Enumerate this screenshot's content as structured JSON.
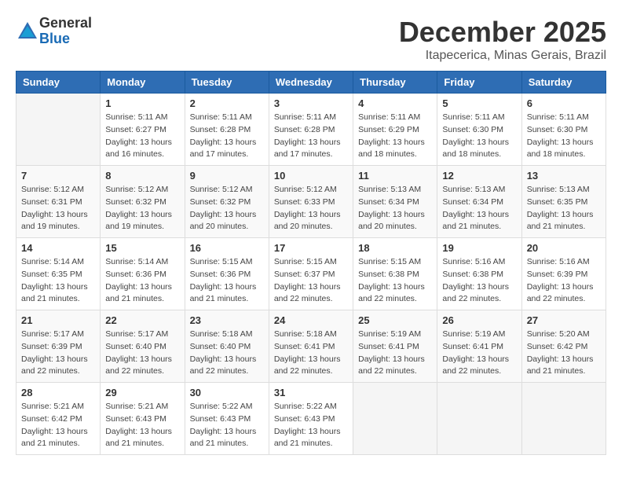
{
  "header": {
    "logo_general": "General",
    "logo_blue": "Blue",
    "month": "December 2025",
    "location": "Itapecerica, Minas Gerais, Brazil"
  },
  "weekdays": [
    "Sunday",
    "Monday",
    "Tuesday",
    "Wednesday",
    "Thursday",
    "Friday",
    "Saturday"
  ],
  "weeks": [
    [
      {
        "day": "",
        "info": ""
      },
      {
        "day": "1",
        "info": "Sunrise: 5:11 AM\nSunset: 6:27 PM\nDaylight: 13 hours\nand 16 minutes."
      },
      {
        "day": "2",
        "info": "Sunrise: 5:11 AM\nSunset: 6:28 PM\nDaylight: 13 hours\nand 17 minutes."
      },
      {
        "day": "3",
        "info": "Sunrise: 5:11 AM\nSunset: 6:28 PM\nDaylight: 13 hours\nand 17 minutes."
      },
      {
        "day": "4",
        "info": "Sunrise: 5:11 AM\nSunset: 6:29 PM\nDaylight: 13 hours\nand 18 minutes."
      },
      {
        "day": "5",
        "info": "Sunrise: 5:11 AM\nSunset: 6:30 PM\nDaylight: 13 hours\nand 18 minutes."
      },
      {
        "day": "6",
        "info": "Sunrise: 5:11 AM\nSunset: 6:30 PM\nDaylight: 13 hours\nand 18 minutes."
      }
    ],
    [
      {
        "day": "7",
        "info": "Sunrise: 5:12 AM\nSunset: 6:31 PM\nDaylight: 13 hours\nand 19 minutes."
      },
      {
        "day": "8",
        "info": "Sunrise: 5:12 AM\nSunset: 6:32 PM\nDaylight: 13 hours\nand 19 minutes."
      },
      {
        "day": "9",
        "info": "Sunrise: 5:12 AM\nSunset: 6:32 PM\nDaylight: 13 hours\nand 20 minutes."
      },
      {
        "day": "10",
        "info": "Sunrise: 5:12 AM\nSunset: 6:33 PM\nDaylight: 13 hours\nand 20 minutes."
      },
      {
        "day": "11",
        "info": "Sunrise: 5:13 AM\nSunset: 6:34 PM\nDaylight: 13 hours\nand 20 minutes."
      },
      {
        "day": "12",
        "info": "Sunrise: 5:13 AM\nSunset: 6:34 PM\nDaylight: 13 hours\nand 21 minutes."
      },
      {
        "day": "13",
        "info": "Sunrise: 5:13 AM\nSunset: 6:35 PM\nDaylight: 13 hours\nand 21 minutes."
      }
    ],
    [
      {
        "day": "14",
        "info": "Sunrise: 5:14 AM\nSunset: 6:35 PM\nDaylight: 13 hours\nand 21 minutes."
      },
      {
        "day": "15",
        "info": "Sunrise: 5:14 AM\nSunset: 6:36 PM\nDaylight: 13 hours\nand 21 minutes."
      },
      {
        "day": "16",
        "info": "Sunrise: 5:15 AM\nSunset: 6:36 PM\nDaylight: 13 hours\nand 21 minutes."
      },
      {
        "day": "17",
        "info": "Sunrise: 5:15 AM\nSunset: 6:37 PM\nDaylight: 13 hours\nand 22 minutes."
      },
      {
        "day": "18",
        "info": "Sunrise: 5:15 AM\nSunset: 6:38 PM\nDaylight: 13 hours\nand 22 minutes."
      },
      {
        "day": "19",
        "info": "Sunrise: 5:16 AM\nSunset: 6:38 PM\nDaylight: 13 hours\nand 22 minutes."
      },
      {
        "day": "20",
        "info": "Sunrise: 5:16 AM\nSunset: 6:39 PM\nDaylight: 13 hours\nand 22 minutes."
      }
    ],
    [
      {
        "day": "21",
        "info": "Sunrise: 5:17 AM\nSunset: 6:39 PM\nDaylight: 13 hours\nand 22 minutes."
      },
      {
        "day": "22",
        "info": "Sunrise: 5:17 AM\nSunset: 6:40 PM\nDaylight: 13 hours\nand 22 minutes."
      },
      {
        "day": "23",
        "info": "Sunrise: 5:18 AM\nSunset: 6:40 PM\nDaylight: 13 hours\nand 22 minutes."
      },
      {
        "day": "24",
        "info": "Sunrise: 5:18 AM\nSunset: 6:41 PM\nDaylight: 13 hours\nand 22 minutes."
      },
      {
        "day": "25",
        "info": "Sunrise: 5:19 AM\nSunset: 6:41 PM\nDaylight: 13 hours\nand 22 minutes."
      },
      {
        "day": "26",
        "info": "Sunrise: 5:19 AM\nSunset: 6:41 PM\nDaylight: 13 hours\nand 22 minutes."
      },
      {
        "day": "27",
        "info": "Sunrise: 5:20 AM\nSunset: 6:42 PM\nDaylight: 13 hours\nand 21 minutes."
      }
    ],
    [
      {
        "day": "28",
        "info": "Sunrise: 5:21 AM\nSunset: 6:42 PM\nDaylight: 13 hours\nand 21 minutes."
      },
      {
        "day": "29",
        "info": "Sunrise: 5:21 AM\nSunset: 6:43 PM\nDaylight: 13 hours\nand 21 minutes."
      },
      {
        "day": "30",
        "info": "Sunrise: 5:22 AM\nSunset: 6:43 PM\nDaylight: 13 hours\nand 21 minutes."
      },
      {
        "day": "31",
        "info": "Sunrise: 5:22 AM\nSunset: 6:43 PM\nDaylight: 13 hours\nand 21 minutes."
      },
      {
        "day": "",
        "info": ""
      },
      {
        "day": "",
        "info": ""
      },
      {
        "day": "",
        "info": ""
      }
    ]
  ]
}
